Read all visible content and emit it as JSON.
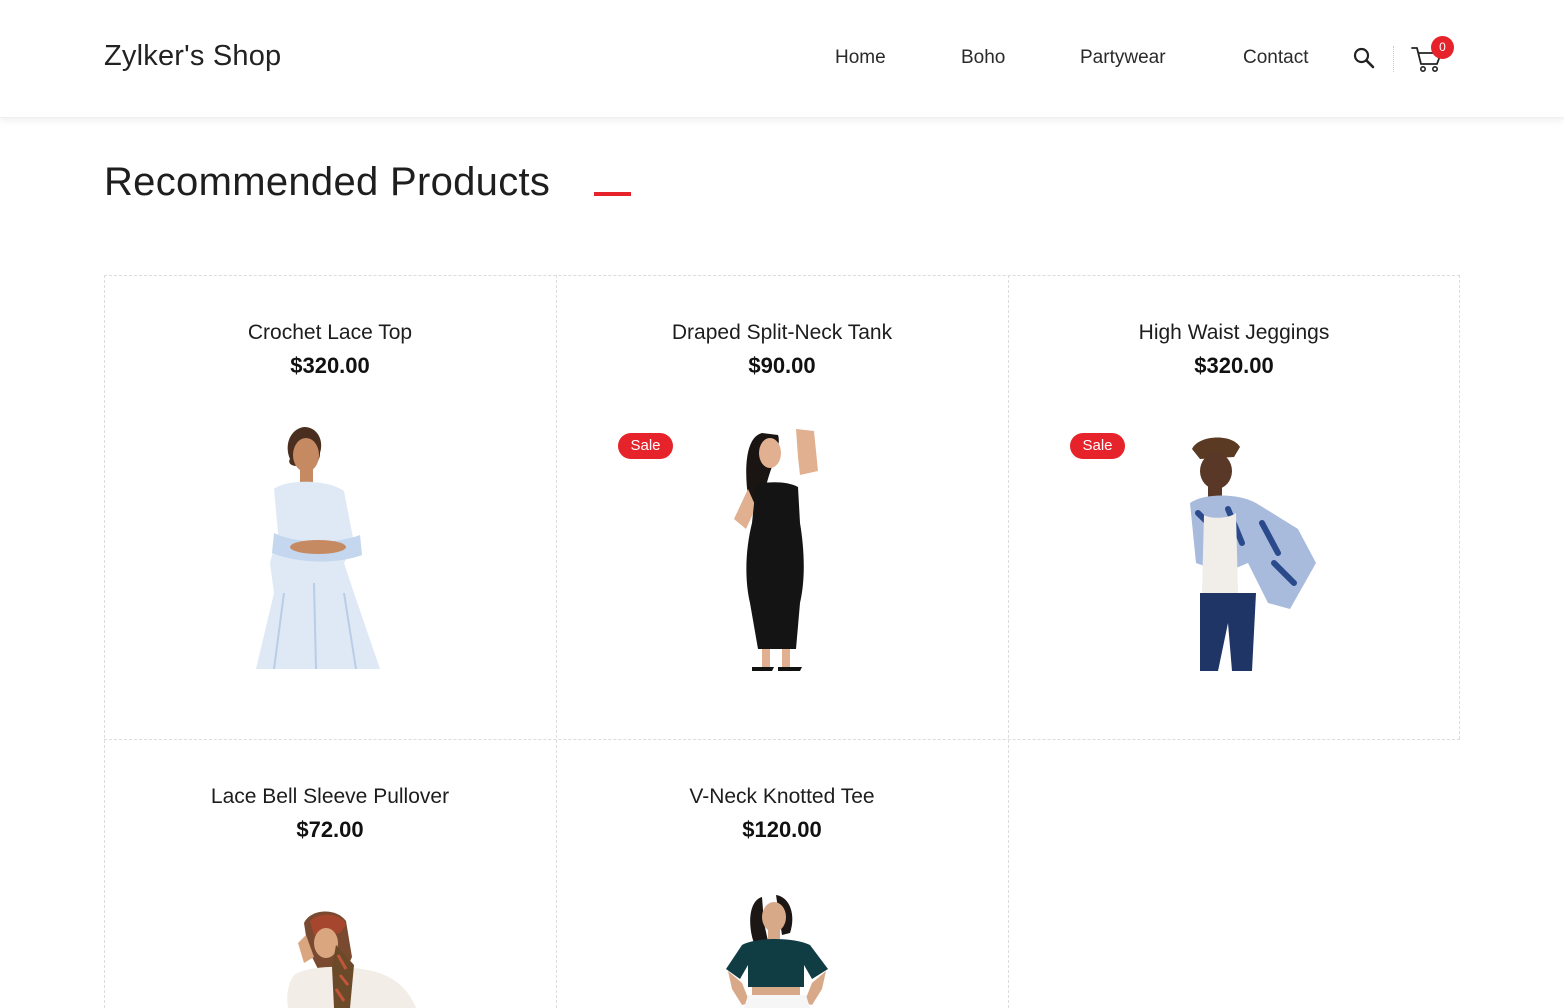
{
  "header": {
    "logo": "Zylker's Shop",
    "nav": [
      {
        "label": "Home"
      },
      {
        "label": "Boho"
      },
      {
        "label": "Partywear"
      },
      {
        "label": "Contact"
      }
    ],
    "cart_count": "0"
  },
  "main": {
    "section_title": "Recommended Products",
    "products": [
      {
        "name": "Crochet Lace Top",
        "price": "$320.00",
        "badge": ""
      },
      {
        "name": "Draped Split-Neck Tank",
        "price": "$90.00",
        "badge": "Sale"
      },
      {
        "name": "High Waist Jeggings",
        "price": "$320.00",
        "badge": "Sale"
      },
      {
        "name": "Lace Bell Sleeve Pullover",
        "price": "$72.00",
        "badge": ""
      },
      {
        "name": "V-Neck Knotted Tee",
        "price": "$120.00",
        "badge": ""
      }
    ]
  },
  "colors": {
    "accent": "#e6232b",
    "text": "#1a1a1a",
    "grid": "#dcdcdc"
  }
}
